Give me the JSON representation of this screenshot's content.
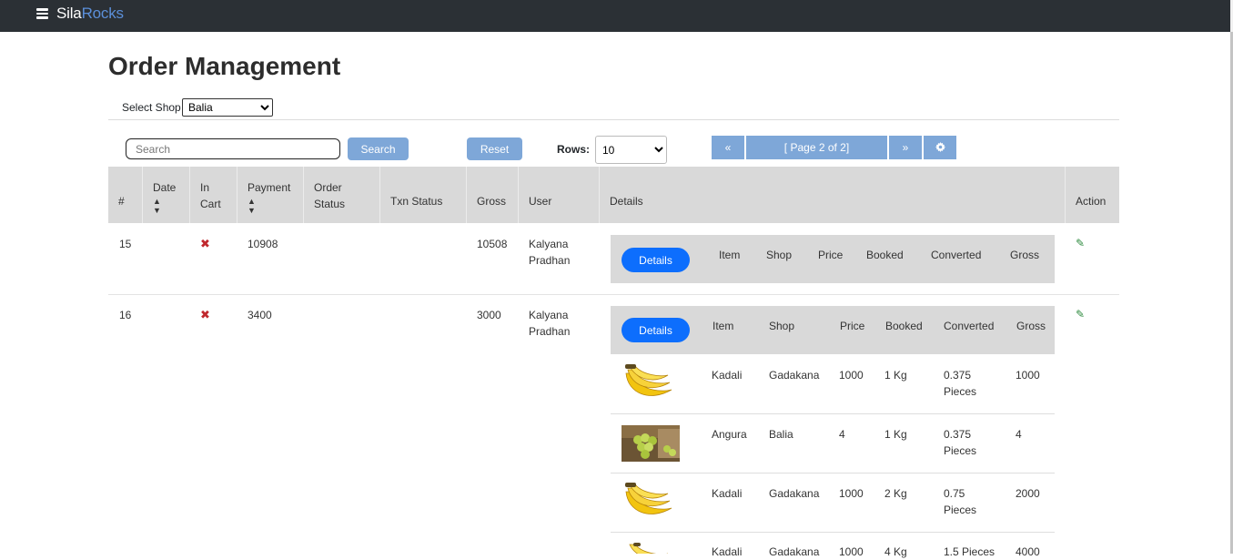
{
  "app": {
    "brand_part1": "Sila",
    "brand_part2": "Rocks"
  },
  "page": {
    "title": "Order Management"
  },
  "shop_filter": {
    "label": "Select Shop",
    "selected": "Balia"
  },
  "toolbar": {
    "search_placeholder": "Search",
    "search_label": "Search",
    "reset_label": "Reset",
    "rows_label": "Rows:",
    "rows_value": "10",
    "pager_first": "«",
    "pager_status": "[ Page 2 of 2]",
    "pager_next": "»"
  },
  "table": {
    "headers": {
      "num": "#",
      "date": "Date",
      "in_cart_1": "In",
      "in_cart_2": "Cart",
      "payment": "Payment",
      "order_status_1": "Order",
      "order_status_2": "Status",
      "txn_status": "Txn Status",
      "gross": "Gross",
      "user": "User",
      "details": "Details",
      "action": "Action"
    },
    "rows": [
      {
        "num": "15",
        "payment": "10908",
        "gross": "10508",
        "user_first": "Kalyana",
        "user_last": "Pradhan"
      },
      {
        "num": "16",
        "payment": "3400",
        "gross": "3000",
        "user_first": "Kalyana",
        "user_last": "Pradhan"
      }
    ]
  },
  "details": {
    "button_label": "Details",
    "headers": {
      "item": "Item",
      "shop": "Shop",
      "price": "Price",
      "booked": "Booked",
      "converted": "Converted",
      "gross": "Gross"
    },
    "items": [
      {
        "item": "Kadali",
        "shop": "Gadakana",
        "price": "1000",
        "booked": "1 Kg",
        "converted_1": "0.375",
        "converted_2": "Pieces",
        "gross": "1000",
        "image": "banana"
      },
      {
        "item": "Angura",
        "shop": "Balia",
        "price": "4",
        "booked": "1 Kg",
        "converted_1": "0.375",
        "converted_2": "Pieces",
        "gross": "4",
        "image": "grapes"
      },
      {
        "item": "Kadali",
        "shop": "Gadakana",
        "price": "1000",
        "booked": "2 Kg",
        "converted_1": "0.75",
        "converted_2": "Pieces",
        "gross": "2000",
        "image": "banana"
      },
      {
        "item": "Kadali",
        "shop": "Gadakana",
        "price": "1000",
        "booked": "4 Kg",
        "converted_1": "1.5 Pieces",
        "converted_2": "",
        "gross": "4000",
        "image": "banana"
      }
    ]
  },
  "icons": {
    "menu": "hamburger-icon",
    "settings": "gear-icon",
    "not_in_cart": "x-icon",
    "edit": "pencil-icon",
    "sort": "sort-icon"
  },
  "colors": {
    "navbar": "#2b3035",
    "brand_accent": "#5b8fd9",
    "primary": "#0d6efd",
    "light_button": "#7ea7d8",
    "header_bg": "#d9d9d9",
    "x_mark": "#c0282d",
    "pencil": "#2d8a3e"
  }
}
